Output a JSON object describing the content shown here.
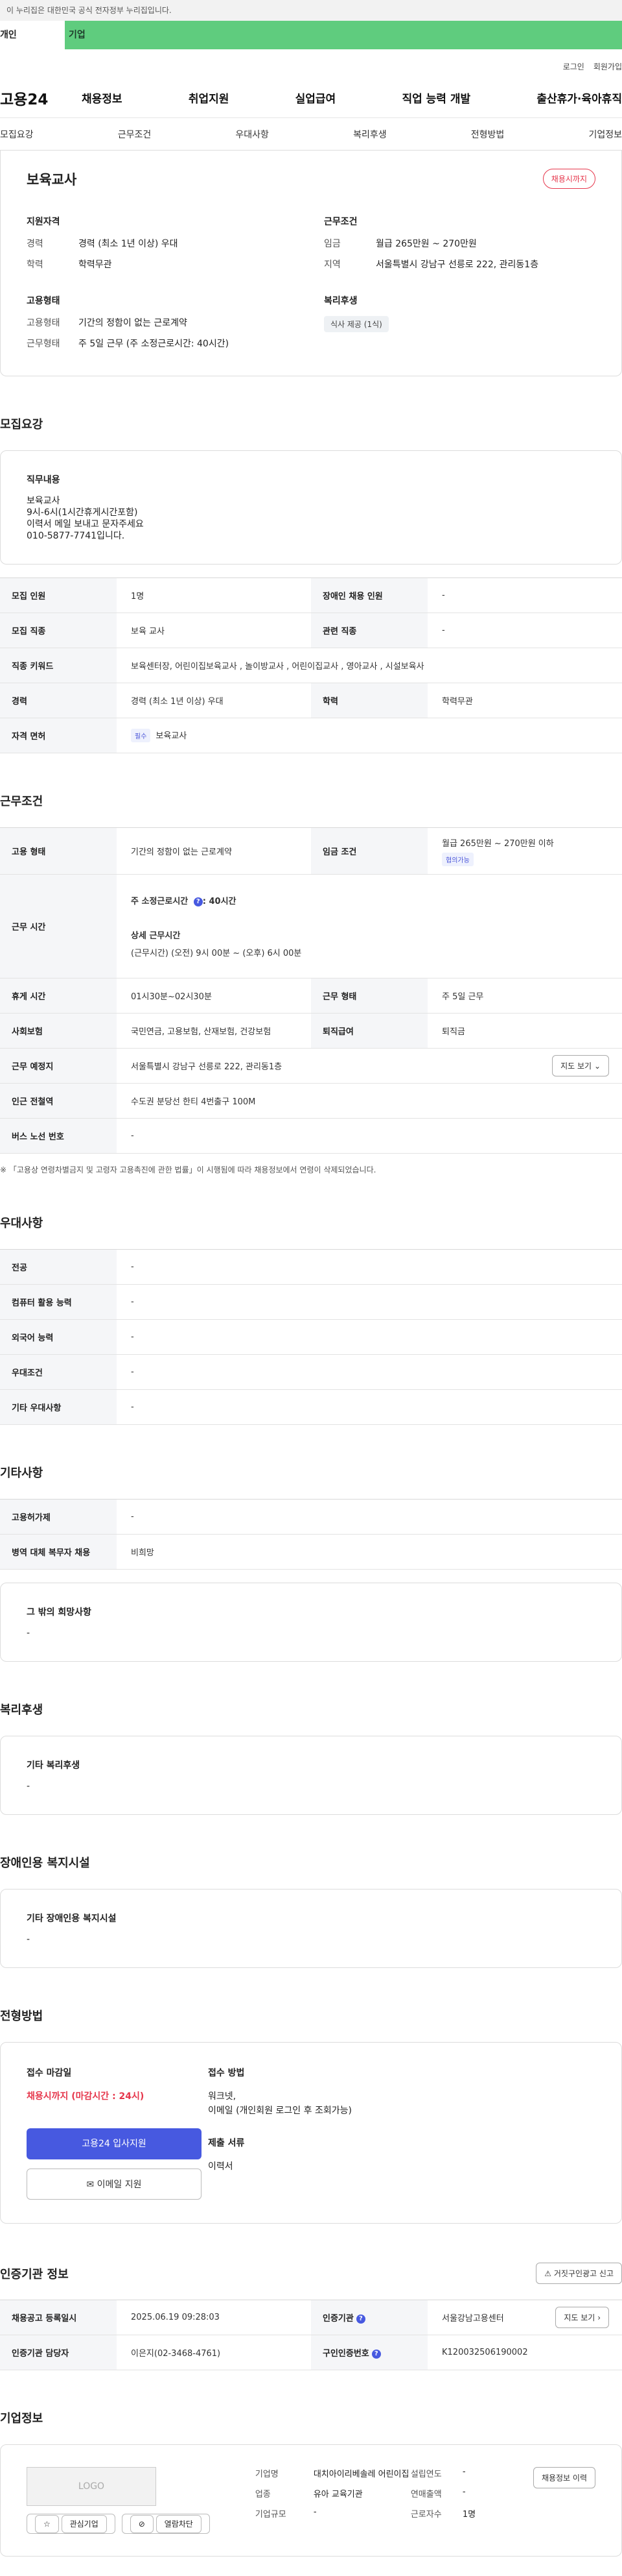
{
  "gov_banner": "이 누리집은 대한민국 공식 전자정부 누리집입니다.",
  "top_tabs": [
    "개인",
    "기업"
  ],
  "util": [
    "로그인",
    "회원가입"
  ],
  "logo": "고용24",
  "gnb": [
    "채용정보",
    "취업지원",
    "실업급여",
    "직업 능력 개발",
    "출산휴가·육아휴직"
  ],
  "snb": [
    "모집요강",
    "근무조건",
    "우대사항",
    "복리후생",
    "전형방법",
    "기업정보"
  ],
  "summary": {
    "title": "보육교사",
    "status": "채용시까지",
    "qual_title": "지원자격",
    "qual": [
      {
        "k": "경력",
        "v": "경력 (최소 1년 이상) 우대"
      },
      {
        "k": "학력",
        "v": "학력무관"
      }
    ],
    "emp_title": "고용형태",
    "emp": [
      {
        "k": "고용형태",
        "v": "기간의 정함이 없는 근로계약"
      },
      {
        "k": "근무형태",
        "v": "주 5일 근무 (주 소정근로시간: 40시간)"
      }
    ],
    "cond_title": "근무조건",
    "cond": [
      {
        "k": "임금",
        "v": "월급 265만원 ~ 270만원"
      },
      {
        "k": "지역",
        "v": "서울특별시 강남구 선릉로 222, 관리동1층"
      }
    ],
    "welfare_title": "복리후생",
    "welfare_chip": "식사 제공 (1식)"
  },
  "recruit": {
    "section": "모집요강",
    "duty_title": "직무내용",
    "duty_lines": [
      "보육교사",
      "9시-6시(1시간휴게시간포함)",
      "이력서 메일 보내고 문자주세요",
      "010-5877-7741입니다."
    ],
    "rows": [
      {
        "k1": "모집 인원",
        "v1": "1명",
        "k2": "장애인 채용 인원",
        "v2": "-"
      },
      {
        "k1": "모집 직종",
        "v1": "보육 교사",
        "k2": "관련 직종",
        "v2": "-"
      },
      {
        "k1": "직종 키워드",
        "v1": "보육센터장, 어린이집보육교사 , 놀이방교사 , 어린이집교사 , 영아교사 , 시설보육사",
        "k2": "",
        "v2": ""
      },
      {
        "k1": "경력",
        "v1": "경력 (최소 1년 이상) 우대",
        "k2": "학력",
        "v2": "학력무관"
      },
      {
        "k1": "자격 면허",
        "v1": "보육교사",
        "k2": "",
        "v2": ""
      }
    ],
    "required_badge": "필수"
  },
  "work": {
    "section": "근무조건",
    "type_k": "고용 형태",
    "type_v": "기간의 정함이 없는 근로계약",
    "wage_k": "임금 조건",
    "wage_v": "월급 265만원 ~ 270만원 이하",
    "wage_badge": "협의가능",
    "hours_k": "근무 시간",
    "weekly": "주 소정근로시간",
    "weekly_val": ": 40시간",
    "detail_title": "상세 근무시간",
    "detail_val": "(근무시간) (오전) 9시 00분 ~ (오후) 6시 00분",
    "rows": [
      {
        "k1": "휴게 시간",
        "v1": "01시30분~02시30분",
        "k2": "근무 형태",
        "v2": "주 5일 근무"
      },
      {
        "k1": "사회보험",
        "v1": "국민연금, 고용보험, 산재보험, 건강보험",
        "k2": "퇴직급여",
        "v2": "퇴직금"
      }
    ],
    "place_k": "근무 예정지",
    "place_v": "서울특별시 강남구 선릉로 222, 관리동1층",
    "map_btn": "지도 보기",
    "subway_k": "인근 전철역",
    "subway_v": "수도권 분당선 한티 4번출구 100M",
    "bus_k": "버스 노선 번호",
    "bus_v": "-",
    "note": "※ 「고용상 연령차별금지 및 고령자 고용촉진에 관한 법률」이 시행됨에 따라 채용정보에서 연령이 삭제되었습니다."
  },
  "pref": {
    "section": "우대사항",
    "rows": [
      {
        "k": "전공",
        "v": "-"
      },
      {
        "k": "컴퓨터 활용 능력",
        "v": "-"
      },
      {
        "k": "외국어 능력",
        "v": "-"
      },
      {
        "k": "우대조건",
        "v": "-"
      },
      {
        "k": "기타 우대사항",
        "v": "-"
      }
    ]
  },
  "etc": {
    "section": "기타사항",
    "rows": [
      {
        "k": "고용허가제",
        "v": "-"
      },
      {
        "k": "병역 대체 복무자 채용",
        "v": "비희망"
      }
    ],
    "hope_title": "그 밖의 희망사항",
    "hope_val": "-"
  },
  "welfare": {
    "section": "복리후생",
    "title": "기타 복리후생",
    "val": "-"
  },
  "disabled": {
    "section": "장애인용 복지시설",
    "title": "기타 장애인용 복지시설",
    "val": "-"
  },
  "process": {
    "section": "전형방법",
    "deadline_title": "접수 마감일",
    "deadline": "채용시까지 (마감시간 : 24시)",
    "apply_btn": "고용24 입사지원",
    "email_btn": "이메일 지원",
    "method_title": "접수 방법",
    "method": [
      "워크넷,",
      "이메일 (개인회원 로그인 후 조회가능)"
    ],
    "docs_title": "제출 서류",
    "docs": "이력서"
  },
  "cert": {
    "section": "인증기관 정보",
    "report_btn": "거짓구인광고 신고",
    "reg_k": "채용공고 등록일시",
    "reg_v": "2025.06.19 09:28:03",
    "org_k": "인증기관",
    "org_v": "서울강남고용센터",
    "map_btn": "지도 보기",
    "mgr_k": "인증기관 담당자",
    "mgr_v": "이은지(02-3468-4761)",
    "num_k": "구인인증번호",
    "num_v": "K120032506190002"
  },
  "company": {
    "section": "기업정보",
    "logo_text": "LOGO",
    "interest_btn": "관심기업",
    "block_btn": "열람차단",
    "name_k": "기업명",
    "name_v": "대치아이리베솔레 어린이집",
    "industry_k": "업종",
    "industry_v": "유아 교육기관",
    "size_k": "기업규모",
    "size_v": "-",
    "year_k": "설립연도",
    "year_v": "-",
    "sales_k": "연매출액",
    "sales_v": "-",
    "staff_k": "근로자수",
    "staff_v": "1명",
    "detail_btn": "채용정보 이력"
  }
}
